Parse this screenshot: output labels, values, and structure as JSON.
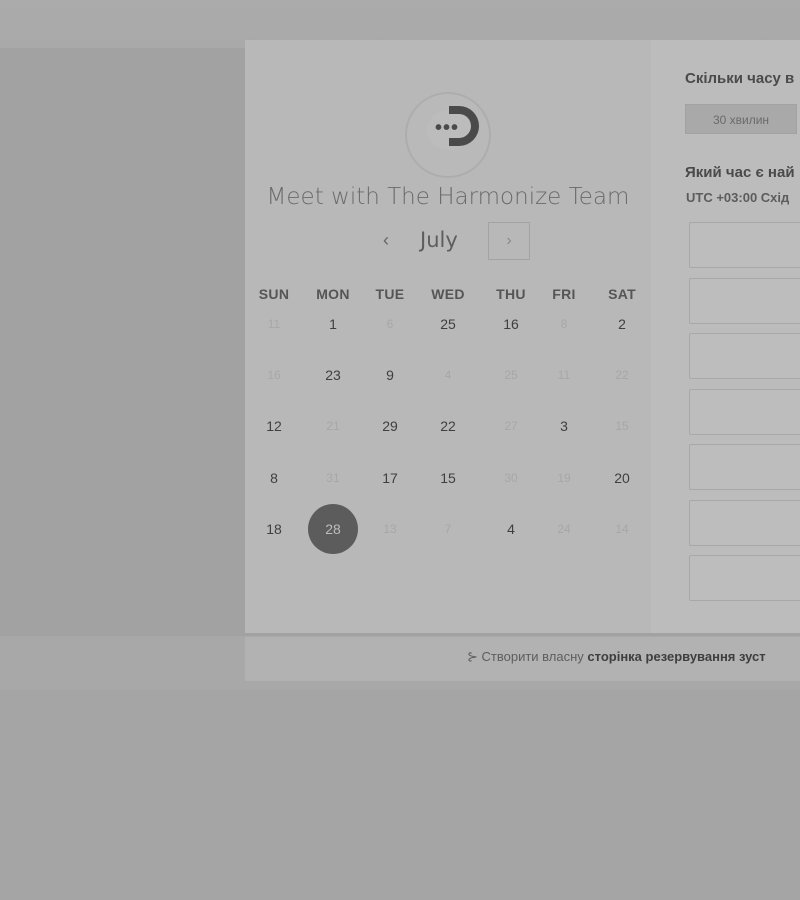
{
  "calendar": {
    "title": "Meet with The Harmonize Team",
    "month": "July",
    "prev_icon": "‹",
    "next_icon": "›",
    "weekdays": [
      "SUN",
      "MON",
      "TUE",
      "WED",
      "THU",
      "FRI",
      "SAT"
    ],
    "rows": [
      [
        {
          "d": "11",
          "dim": true
        },
        {
          "d": "1",
          "dim": false
        },
        {
          "d": "6",
          "dim": true
        },
        {
          "d": "25",
          "dim": false
        },
        {
          "d": "16",
          "dim": false
        },
        {
          "d": "8",
          "dim": true
        },
        {
          "d": "2",
          "dim": false
        }
      ],
      [
        {
          "d": "16",
          "dim": true
        },
        {
          "d": "23",
          "dim": false
        },
        {
          "d": "9",
          "dim": false
        },
        {
          "d": "4",
          "dim": true
        },
        {
          "d": "25",
          "dim": true
        },
        {
          "d": "11",
          "dim": true
        },
        {
          "d": "22",
          "dim": true
        }
      ],
      [
        {
          "d": "12",
          "dim": false
        },
        {
          "d": "21",
          "dim": true
        },
        {
          "d": "29",
          "dim": false
        },
        {
          "d": "22",
          "dim": false
        },
        {
          "d": "27",
          "dim": true
        },
        {
          "d": "3",
          "dim": false
        },
        {
          "d": "15",
          "dim": true
        }
      ],
      [
        {
          "d": "8",
          "dim": false
        },
        {
          "d": "31",
          "dim": true
        },
        {
          "d": "17",
          "dim": false
        },
        {
          "d": "15",
          "dim": false
        },
        {
          "d": "30",
          "dim": true
        },
        {
          "d": "19",
          "dim": true
        },
        {
          "d": "20",
          "dim": false
        }
      ],
      [
        {
          "d": "18",
          "dim": false
        },
        {
          "d": "28",
          "dim": false,
          "selected": true
        },
        {
          "d": "13",
          "dim": true
        },
        {
          "d": "7",
          "dim": true
        },
        {
          "d": "4",
          "dim": false
        },
        {
          "d": "24",
          "dim": true
        },
        {
          "d": "14",
          "dim": true
        }
      ]
    ]
  },
  "booking": {
    "duration_question": "Скільки часу в",
    "duration_option": "30 хвилин",
    "time_question": "Який час є най",
    "timezone": "UTC +03:00 Схід",
    "slot_count": 7
  },
  "footer": {
    "icon": "hubspot-sprocket-icon",
    "text_plain": "Створити власну ",
    "text_bold": "сторінка резервування зуст"
  }
}
